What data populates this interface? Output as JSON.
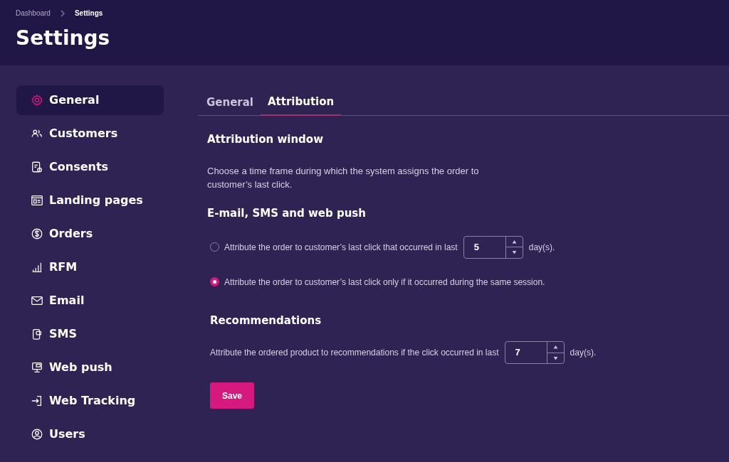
{
  "breadcrumb": [
    {
      "label": "Dashboard",
      "current": false
    },
    {
      "label": "Settings",
      "current": true
    }
  ],
  "title": "Settings",
  "sidebar": {
    "items": [
      {
        "label": "General",
        "selected": true
      },
      {
        "label": "Customers",
        "selected": false
      },
      {
        "label": "Consents",
        "selected": false
      },
      {
        "label": "Landing pages",
        "selected": false
      },
      {
        "label": "Orders",
        "selected": false
      },
      {
        "label": "RFM",
        "selected": false
      },
      {
        "label": "Email",
        "selected": false
      },
      {
        "label": "SMS",
        "selected": false
      },
      {
        "label": "Web push",
        "selected": false
      },
      {
        "label": "Web Tracking",
        "selected": false
      },
      {
        "label": "Users",
        "selected": false
      }
    ]
  },
  "tabs": [
    {
      "label": "General",
      "selected": false
    },
    {
      "label": "Attribution",
      "selected": true
    }
  ],
  "attribution_window": {
    "heading": "Attribution window",
    "description": "Choose a time frame during which the system assigns the order to customer’s last click."
  },
  "channels": {
    "heading": "E-mail, SMS and web push",
    "options": [
      {
        "kind": "days",
        "label": "Attribute the order to customer’s last click that occurred in last",
        "value": "5",
        "suffix": "day(s).",
        "selected": false
      },
      {
        "kind": "plain",
        "label": "Attribute the order to customer’s last click only if it occurred during the same session.",
        "selected": true
      }
    ]
  },
  "recommendations": {
    "heading": "Recommendations",
    "label": "Attribute the ordered product to recommendations if the click occurred in last",
    "value": "7",
    "suffix": "day(s)."
  },
  "save_button": "Save"
}
